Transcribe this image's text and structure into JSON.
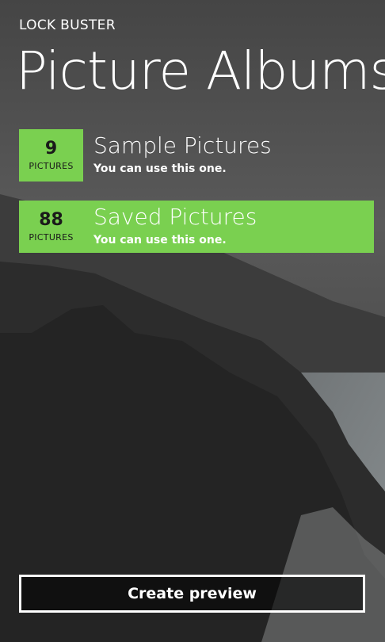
{
  "app": {
    "title": "LOCK BUSTER"
  },
  "page": {
    "title": "Picture Albums"
  },
  "albums": [
    {
      "count": "9",
      "unit": "PICTURES",
      "name": "Sample Pictures",
      "description": "You can use this one.",
      "selected": false
    },
    {
      "count": "88",
      "unit": "PICTURES",
      "name": "Saved Pictures",
      "description": "You can use this one.",
      "selected": true
    }
  ],
  "actions": {
    "create_preview": "Create preview"
  },
  "colors": {
    "accent": "#7ad050",
    "background": "#3a3a3a",
    "text": "#ffffff"
  }
}
